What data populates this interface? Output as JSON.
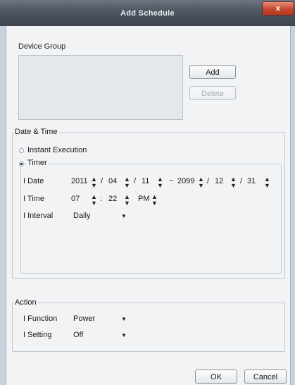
{
  "window": {
    "title": "Add Schedule",
    "close_label": "x"
  },
  "device_group": {
    "label": "Device Group",
    "add_label": "Add",
    "delete_label": "Delete"
  },
  "date_time": {
    "label": "Date & Time",
    "instant_label": "Instant Execution",
    "timer_label": "Timer",
    "date_label": "I Date",
    "start": {
      "year": "2011",
      "month": "04",
      "day": "11"
    },
    "range_sep": "~",
    "end": {
      "year": "2099",
      "month": "12",
      "day": "31"
    },
    "date_sep": "/",
    "time_label": "I Time",
    "hour": "07",
    "time_sep": ":",
    "minute": "22",
    "ampm": "PM",
    "interval_label": "I Interval",
    "interval_value": "Daily"
  },
  "action": {
    "label": "Action",
    "function_label": "I Function",
    "function_value": "Power",
    "setting_label": "I Setting",
    "setting_value": "Off"
  },
  "footer": {
    "ok_label": "OK",
    "cancel_label": "Cancel"
  },
  "icons": {
    "spin": "up-down-spinner-icon",
    "dropdown": "triangle-down-icon",
    "close": "close-x-icon"
  },
  "colors": {
    "titlebar": "#4d5560",
    "close_button": "#c4462f",
    "panel": "#f1f3f5",
    "frame": "#c9d2dc"
  }
}
